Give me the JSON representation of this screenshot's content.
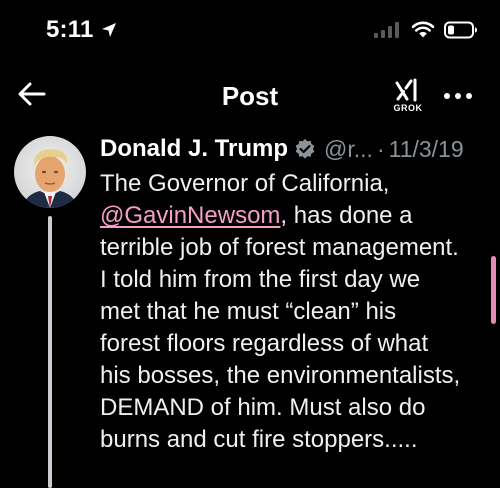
{
  "status_bar": {
    "time": "5:11",
    "icons": [
      "location-arrow-icon",
      "cellular-signal-icon",
      "wifi-icon",
      "battery-icon"
    ]
  },
  "header": {
    "title": "Post",
    "back_icon": "arrow-left-icon",
    "grok_label": "GROK",
    "more_icon": "more-horizontal-icon"
  },
  "post": {
    "author_name": "Donald J. Trump",
    "verified_icon": "verified-badge-icon",
    "handle": "@r...",
    "separator": "·",
    "date": "11/3/19",
    "text_lines": [
      "The Governor of California,",
      "@GavinNewsom",
      ", has done a",
      "terrible job of forest management.",
      "I told him from the first day we",
      "met that he must “clean” his",
      "forest floors regardless of what",
      "his bosses, the environmentalists,",
      "DEMAND of him. Must also do",
      "burns and cut fire stoppers....."
    ]
  },
  "colors": {
    "background": "#000000",
    "text": "#eef0f1",
    "secondary_text": "#8b9298",
    "mention": "#f59fc9",
    "verified_badge": "#8e9398",
    "scroll_indicator": "#e68ab9"
  }
}
